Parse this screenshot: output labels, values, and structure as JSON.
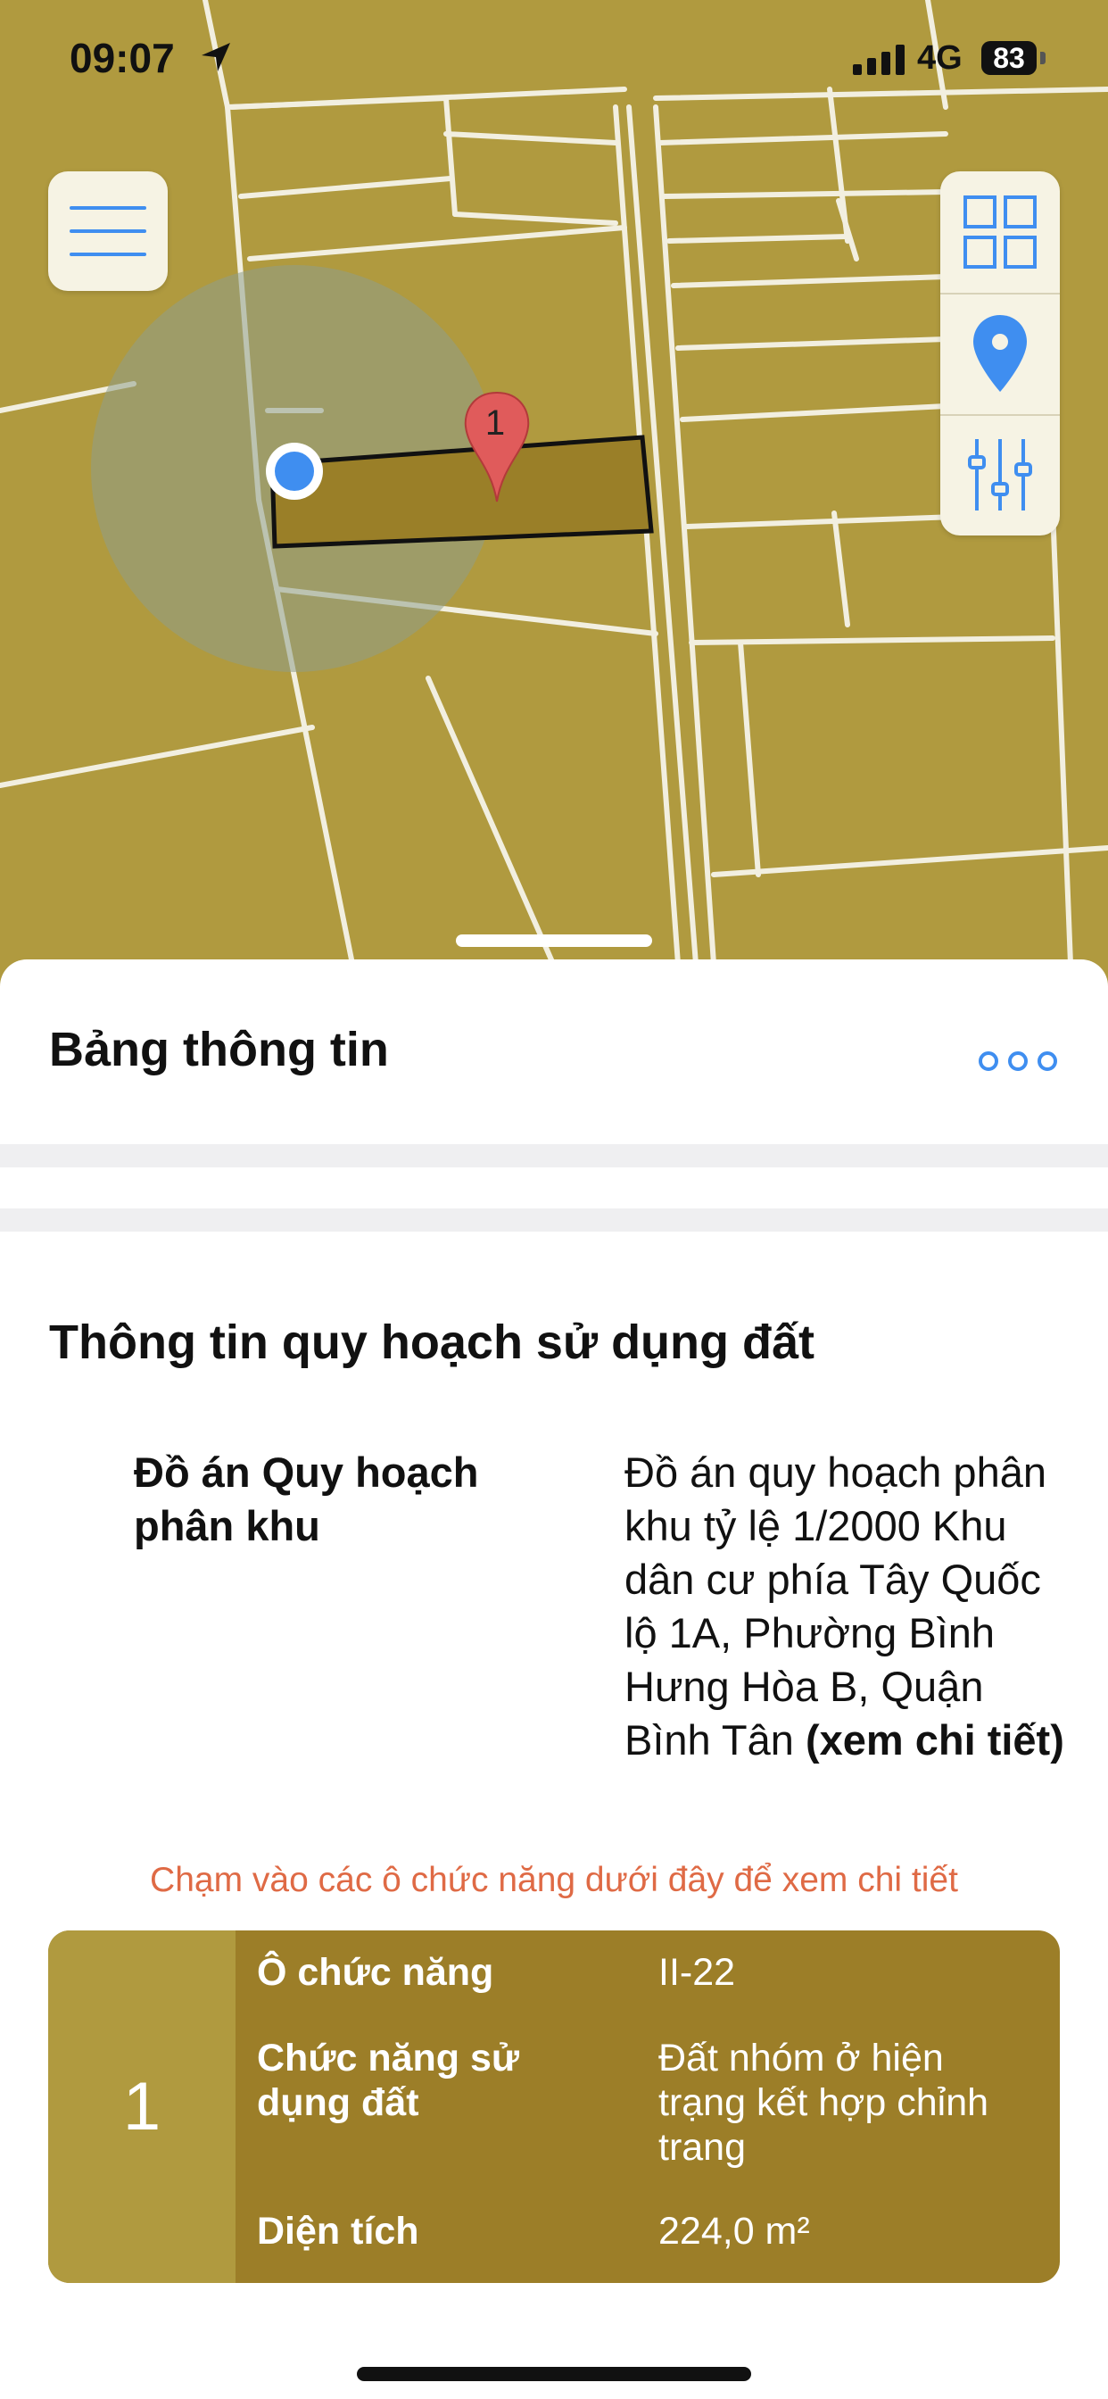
{
  "status_bar": {
    "time": "09:07",
    "network": "4G",
    "battery": "83"
  },
  "map": {
    "menu_icon": "hamburger-menu-icon",
    "tools": [
      {
        "icon": "grid-layers-icon"
      },
      {
        "icon": "location-pin-icon"
      },
      {
        "icon": "sliders-filter-icon"
      }
    ],
    "marker_label": "1",
    "colors": {
      "zone_fill": "#b09a3f",
      "parcel_fill": "#9a7f28",
      "road": "#f2efe0",
      "accent_blue": "#3f8ef0"
    }
  },
  "sheet": {
    "title": "Bảng thông tin",
    "more_icon": "more-dots-icon",
    "section_title": "Thông tin quy hoạch sử dụng đất",
    "plan_label": "Đồ án Quy hoạch phân khu",
    "plan_value": "Đồ án quy hoạch phân khu tỷ lệ 1/2000 Khu dân cư phía Tây Quốc lộ 1A, Phường Bình Hưng Hòa B, Quận Bình Tân",
    "plan_detail_link": "(xem chi tiết)",
    "hint": "Chạm vào các ô chức năng dưới đây để xem chi tiết",
    "zone": {
      "number": "1",
      "rows": [
        {
          "label": "Ô chức năng",
          "value": "II-22"
        },
        {
          "label": "Chức năng sử dụng đất",
          "value": "Đất nhóm ở hiện trạng kết hợp chỉnh trang"
        },
        {
          "label": "Diện tích",
          "value": "224,0 m²"
        }
      ]
    }
  }
}
